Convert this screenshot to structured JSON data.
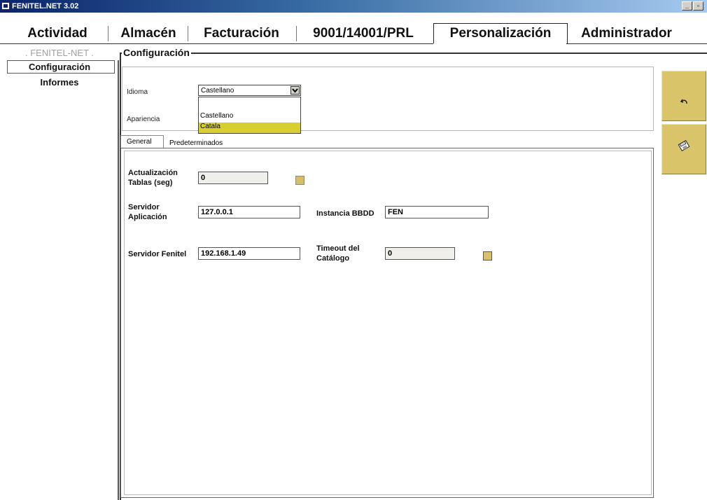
{
  "window": {
    "title": "FENITEL.NET 3.02",
    "btn_min": "_",
    "btn_restore": "▫"
  },
  "menubar": {
    "items": [
      "Actividad",
      "Almacén",
      "Facturación",
      "9001/14001/PRL",
      "Personalización",
      "Administrador"
    ],
    "active": "Personalización"
  },
  "sidebar": {
    "header": ". FENITEL-NET .",
    "items": [
      "Configuración",
      "Informes"
    ],
    "selected": "Configuración"
  },
  "config": {
    "title": "Configuración",
    "idioma_label": "Idioma",
    "idioma_value": "Castellano",
    "idioma_options": [
      "Castellano",
      "Catala"
    ],
    "idioma_highlighted": "Catala",
    "apariencia_label": "Apariencia"
  },
  "tabs": [
    "General",
    "Predeterminados"
  ],
  "general": {
    "act_label1": "Actualización",
    "act_label2": "Tablas (seg)",
    "act_value": "0",
    "srv_app_label1": "Servidor",
    "srv_app_label2": "Aplicación",
    "srv_app_value": "127.0.0.1",
    "instancia_label": "Instancia BBDD",
    "instancia_value": "FEN",
    "srv_fen_label": "Servidor Fenitel",
    "srv_fen_value": "192.168.1.49",
    "timeout_label1": "Timeout del",
    "timeout_label2": "Catálogo",
    "timeout_value": "0"
  },
  "actions": [
    "undo-icon",
    "save-disk-icon"
  ],
  "colors": {
    "accent": "#d9c46a",
    "highlight": "#d6cf2e",
    "titlebar": "#0a246a"
  }
}
